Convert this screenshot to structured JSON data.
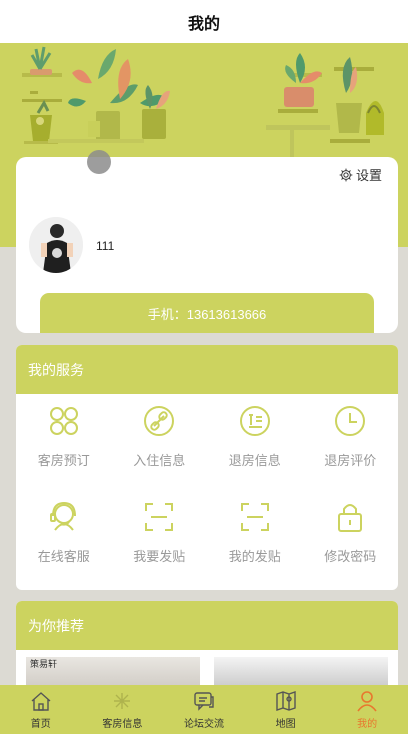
{
  "header": {
    "title": "我的"
  },
  "profile": {
    "settings_label": "设置",
    "username": "111",
    "phone": "手机：13613613666"
  },
  "services": {
    "title": "我的服务",
    "items": [
      {
        "label": "客房预订",
        "icon": "grid-circles-icon"
      },
      {
        "label": "入住信息",
        "icon": "link-icon"
      },
      {
        "label": "退房信息",
        "icon": "document-list-icon"
      },
      {
        "label": "退房评价",
        "icon": "clock-icon"
      },
      {
        "label": "在线客服",
        "icon": "customer-service-icon"
      },
      {
        "label": "我要发贴",
        "icon": "scan-frame-icon"
      },
      {
        "label": "我的发贴",
        "icon": "scan-frame-icon"
      },
      {
        "label": "修改密码",
        "icon": "lock-icon"
      }
    ]
  },
  "recommend": {
    "title": "为你推荐",
    "image_text": "策易轩"
  },
  "tabbar": {
    "items": [
      {
        "label": "首页",
        "icon": "home-icon"
      },
      {
        "label": "客房信息",
        "icon": "room-icon"
      },
      {
        "label": "论坛交流",
        "icon": "chat-icon"
      },
      {
        "label": "地图",
        "icon": "map-icon"
      },
      {
        "label": "我的",
        "icon": "user-icon"
      }
    ],
    "active_index": 4
  },
  "colors": {
    "accent": "#ccd35f",
    "active_tab": "#e8772e",
    "background": "#dcdad3"
  }
}
